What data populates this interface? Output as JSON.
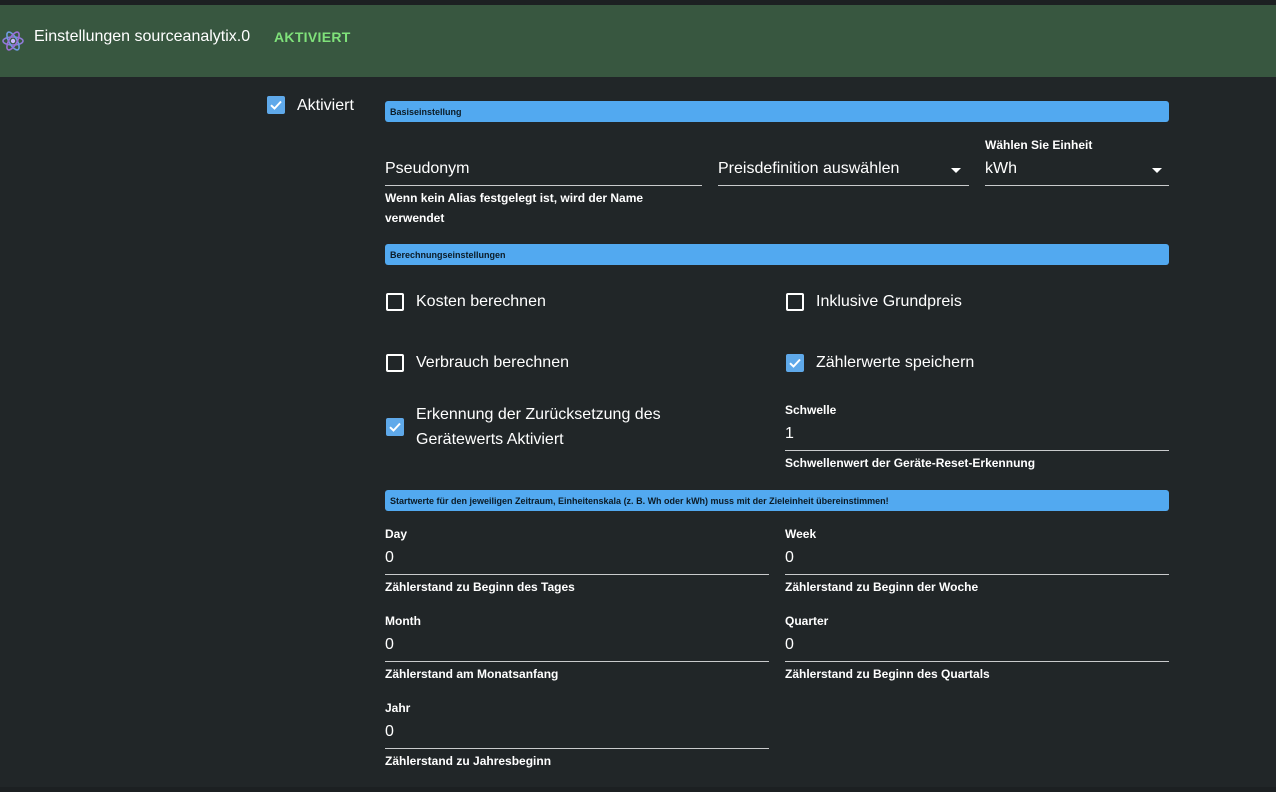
{
  "header": {
    "title": "Einstellungen sourceanalytix.0",
    "state": "AKTIVIERT",
    "logo_icon": "atom-icon"
  },
  "enabled": {
    "label": "Aktiviert",
    "checked": true
  },
  "basic": {
    "section_title": "Basiseinstellung",
    "alias": {
      "value": "Pseudonym",
      "helper": "Wenn kein Alias festgelegt ist, wird der Name verwendet"
    },
    "price": {
      "value": "Preisdefinition auswählen"
    },
    "unit": {
      "label": "Wählen Sie Einheit",
      "value": "kWh"
    }
  },
  "calc": {
    "section_title": "Berechnungseinstellungen",
    "calc_costs": {
      "label": "Kosten berechnen",
      "checked": false
    },
    "incl_base": {
      "label": "Inklusive Grundpreis",
      "checked": false
    },
    "calc_consumption": {
      "label": "Verbrauch berechnen",
      "checked": false
    },
    "store_meter": {
      "label": "Zählerwerte speichern",
      "checked": true
    },
    "reset_detect": {
      "label": "Erkennung der Zurücksetzung des Gerätewerts Aktiviert",
      "checked": true
    },
    "threshold": {
      "label": "Schwelle",
      "value": "1",
      "helper": "Schwellenwert der Geräte-Reset-Erkennung"
    }
  },
  "start": {
    "section_title": "Startwerte für den jeweiligen Zeitraum, Einheitenskala (z. B. Wh oder kWh) muss mit der Zieleinheit übereinstimmen!",
    "day": {
      "label": "Day",
      "value": "0",
      "helper": "Zählerstand zu Beginn des Tages"
    },
    "week": {
      "label": "Week",
      "value": "0",
      "helper": "Zählerstand zu Beginn der Woche"
    },
    "month": {
      "label": "Month",
      "value": "0",
      "helper": "Zählerstand am Monatsanfang"
    },
    "quarter": {
      "label": "Quarter",
      "value": "0",
      "helper": "Zählerstand zu Beginn des Quartals"
    },
    "year": {
      "label": "Jahr",
      "value": "0",
      "helper": "Zählerstand zu Jahresbeginn"
    }
  },
  "colors": {
    "header_bg": "#385740",
    "accent": "#52a9f0",
    "state_green": "#7fe17a",
    "bg": "#212628"
  }
}
